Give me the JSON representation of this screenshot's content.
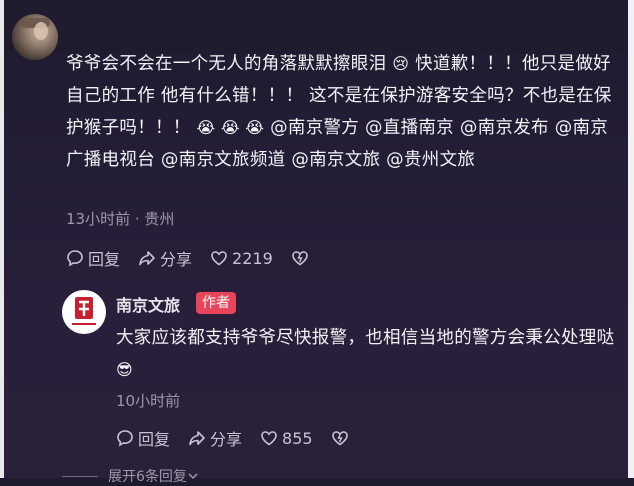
{
  "comment": {
    "text_parts": [
      "爷爷会不会在一个无人的角落默默擦眼泪",
      " 快道歉！！！他只是做好自己的工作 他有什么错！！！ 这不是在保护游客安全吗？不也是在保护猴子吗！！！ ",
      " @南京警方 @直播南京 @南京发布 @南京广播电视台 @南京文旅频道 @南京文旅 @贵州文旅"
    ],
    "emoji_1": "😢",
    "emoji_group": "😭 😭 😭",
    "time_location": "13小时前 · 贵州",
    "reply_label": "回复",
    "share_label": "分享",
    "like_count": "2219"
  },
  "reply": {
    "author": "南京文旅",
    "badge": "作者",
    "text": "大家应该都支持爷爷尽快报警，也相信当地的警方会秉公处理哒",
    "emoji": "😎",
    "time": "10小时前",
    "reply_label": "回复",
    "share_label": "分享",
    "like_count": "855"
  },
  "expand_label": "展开6条回复",
  "colors": {
    "badge": "#e8455a",
    "meta": "#9d97a8",
    "background": "#241d36"
  },
  "icons": [
    "comment-icon",
    "share-icon",
    "heart-icon",
    "dislike-icon",
    "chevron-down-icon"
  ]
}
